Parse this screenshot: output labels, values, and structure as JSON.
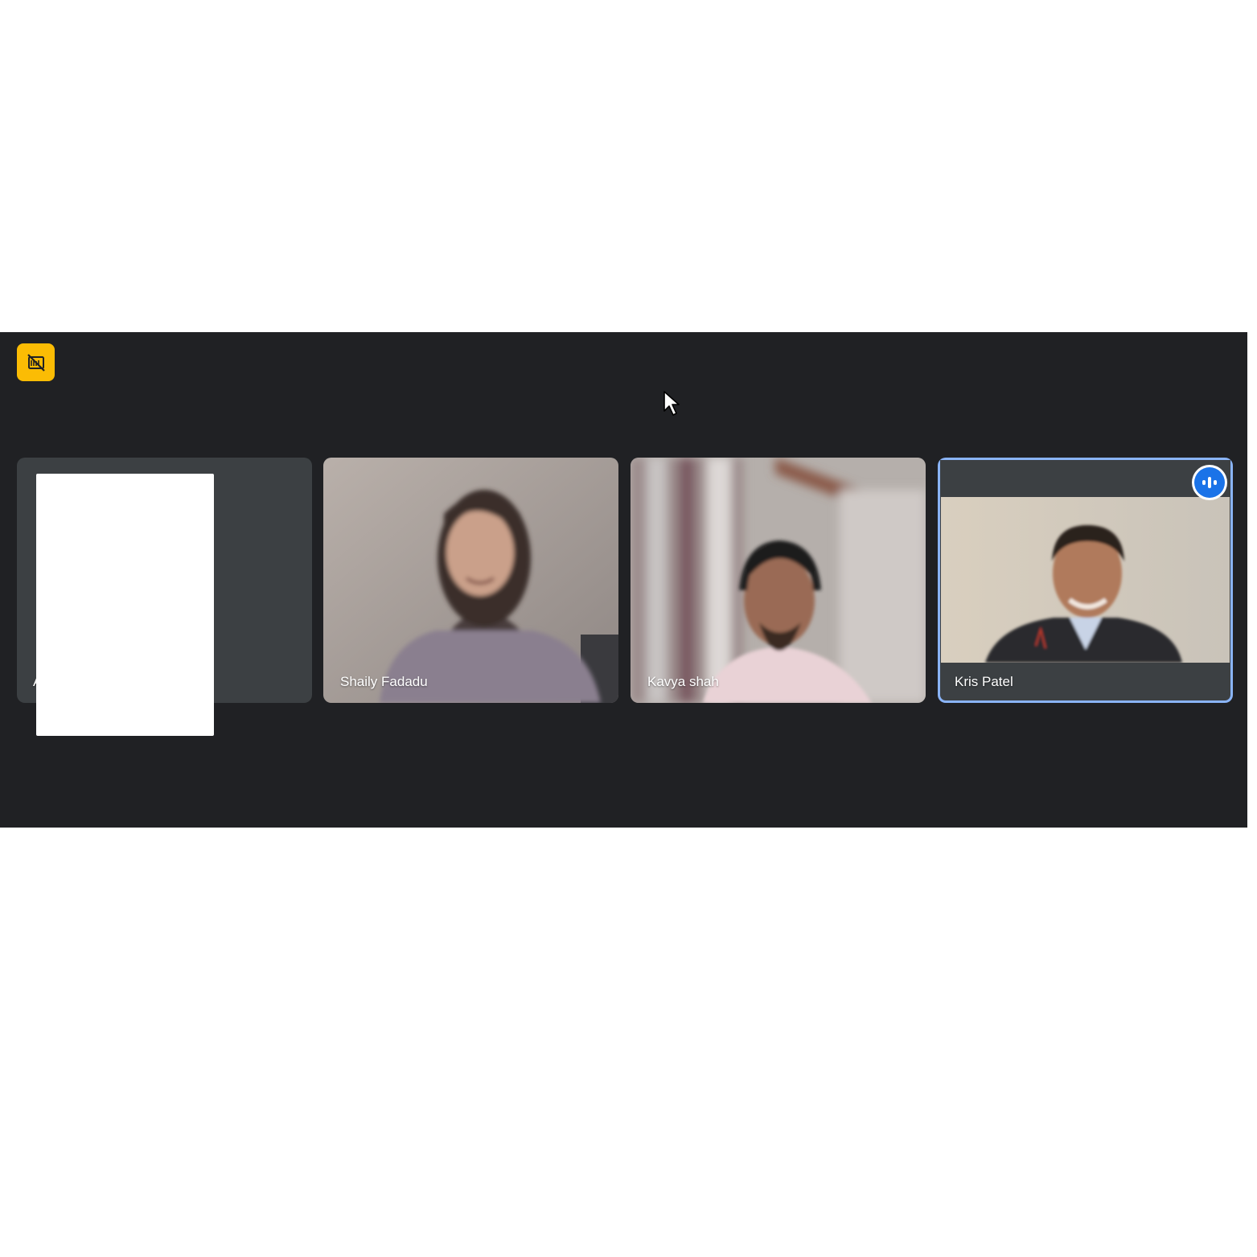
{
  "recording_indicator": {
    "icon": "recording-off-icon",
    "color": "#fbbc04"
  },
  "participants": [
    {
      "name": "A",
      "speaking": false
    },
    {
      "name": "Shaily Fadadu",
      "speaking": false
    },
    {
      "name": "Kavya shah",
      "speaking": false
    },
    {
      "name": "Kris Patel",
      "speaking": true
    }
  ],
  "colors": {
    "background": "#202124",
    "tile": "#3c4043",
    "active_speaker_border": "#8ab4f8",
    "speaking_indicator": "#1a73e8"
  }
}
